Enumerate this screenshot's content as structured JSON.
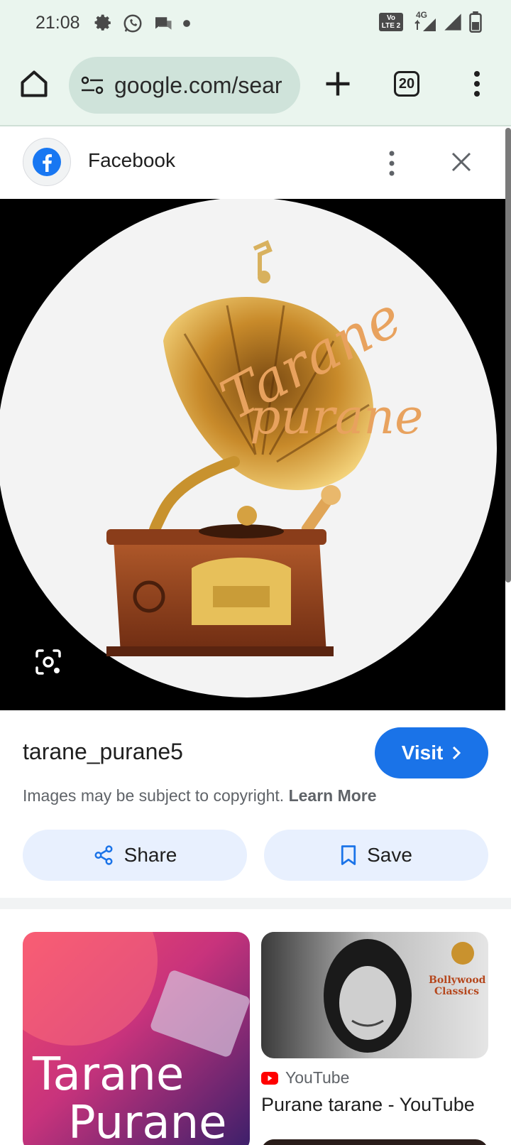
{
  "status_bar": {
    "time": "21:08",
    "icons": [
      "settings-icon",
      "whatsapp-icon",
      "chat-icon",
      "dot-icon"
    ],
    "right_icons": [
      "volte-lte2-icon",
      "4g-data-icon",
      "signal-icon",
      "signal-icon",
      "battery-icon"
    ],
    "network_label": "4G",
    "volte_label_1": "Vo",
    "volte_label_2": "LTE 2"
  },
  "browser": {
    "url": "google.com/sear",
    "tab_count": "20"
  },
  "source_header": {
    "title": "Facebook"
  },
  "image_result": {
    "brand_text_1": "Tarane",
    "brand_text_2": "purane"
  },
  "details": {
    "site_name": "tarane_purane5",
    "visit_label": "Visit",
    "copyright_text": "Images may be subject to copyright.",
    "learn_more_label": "Learn More",
    "share_label": "Share",
    "save_label": "Save"
  },
  "related": {
    "card1": {
      "title_line1": "Tarane",
      "title_line2": "Purane"
    },
    "card2": {
      "overlay_text_1": "Bollywood",
      "overlay_text_2": "Classics",
      "source": "YouTube",
      "title": "Purane tarane - YouTube"
    }
  },
  "colors": {
    "accent": "#1a73e8",
    "toolbar_bg": "#eaf5ee",
    "pill_bg": "#e8f0fe"
  }
}
